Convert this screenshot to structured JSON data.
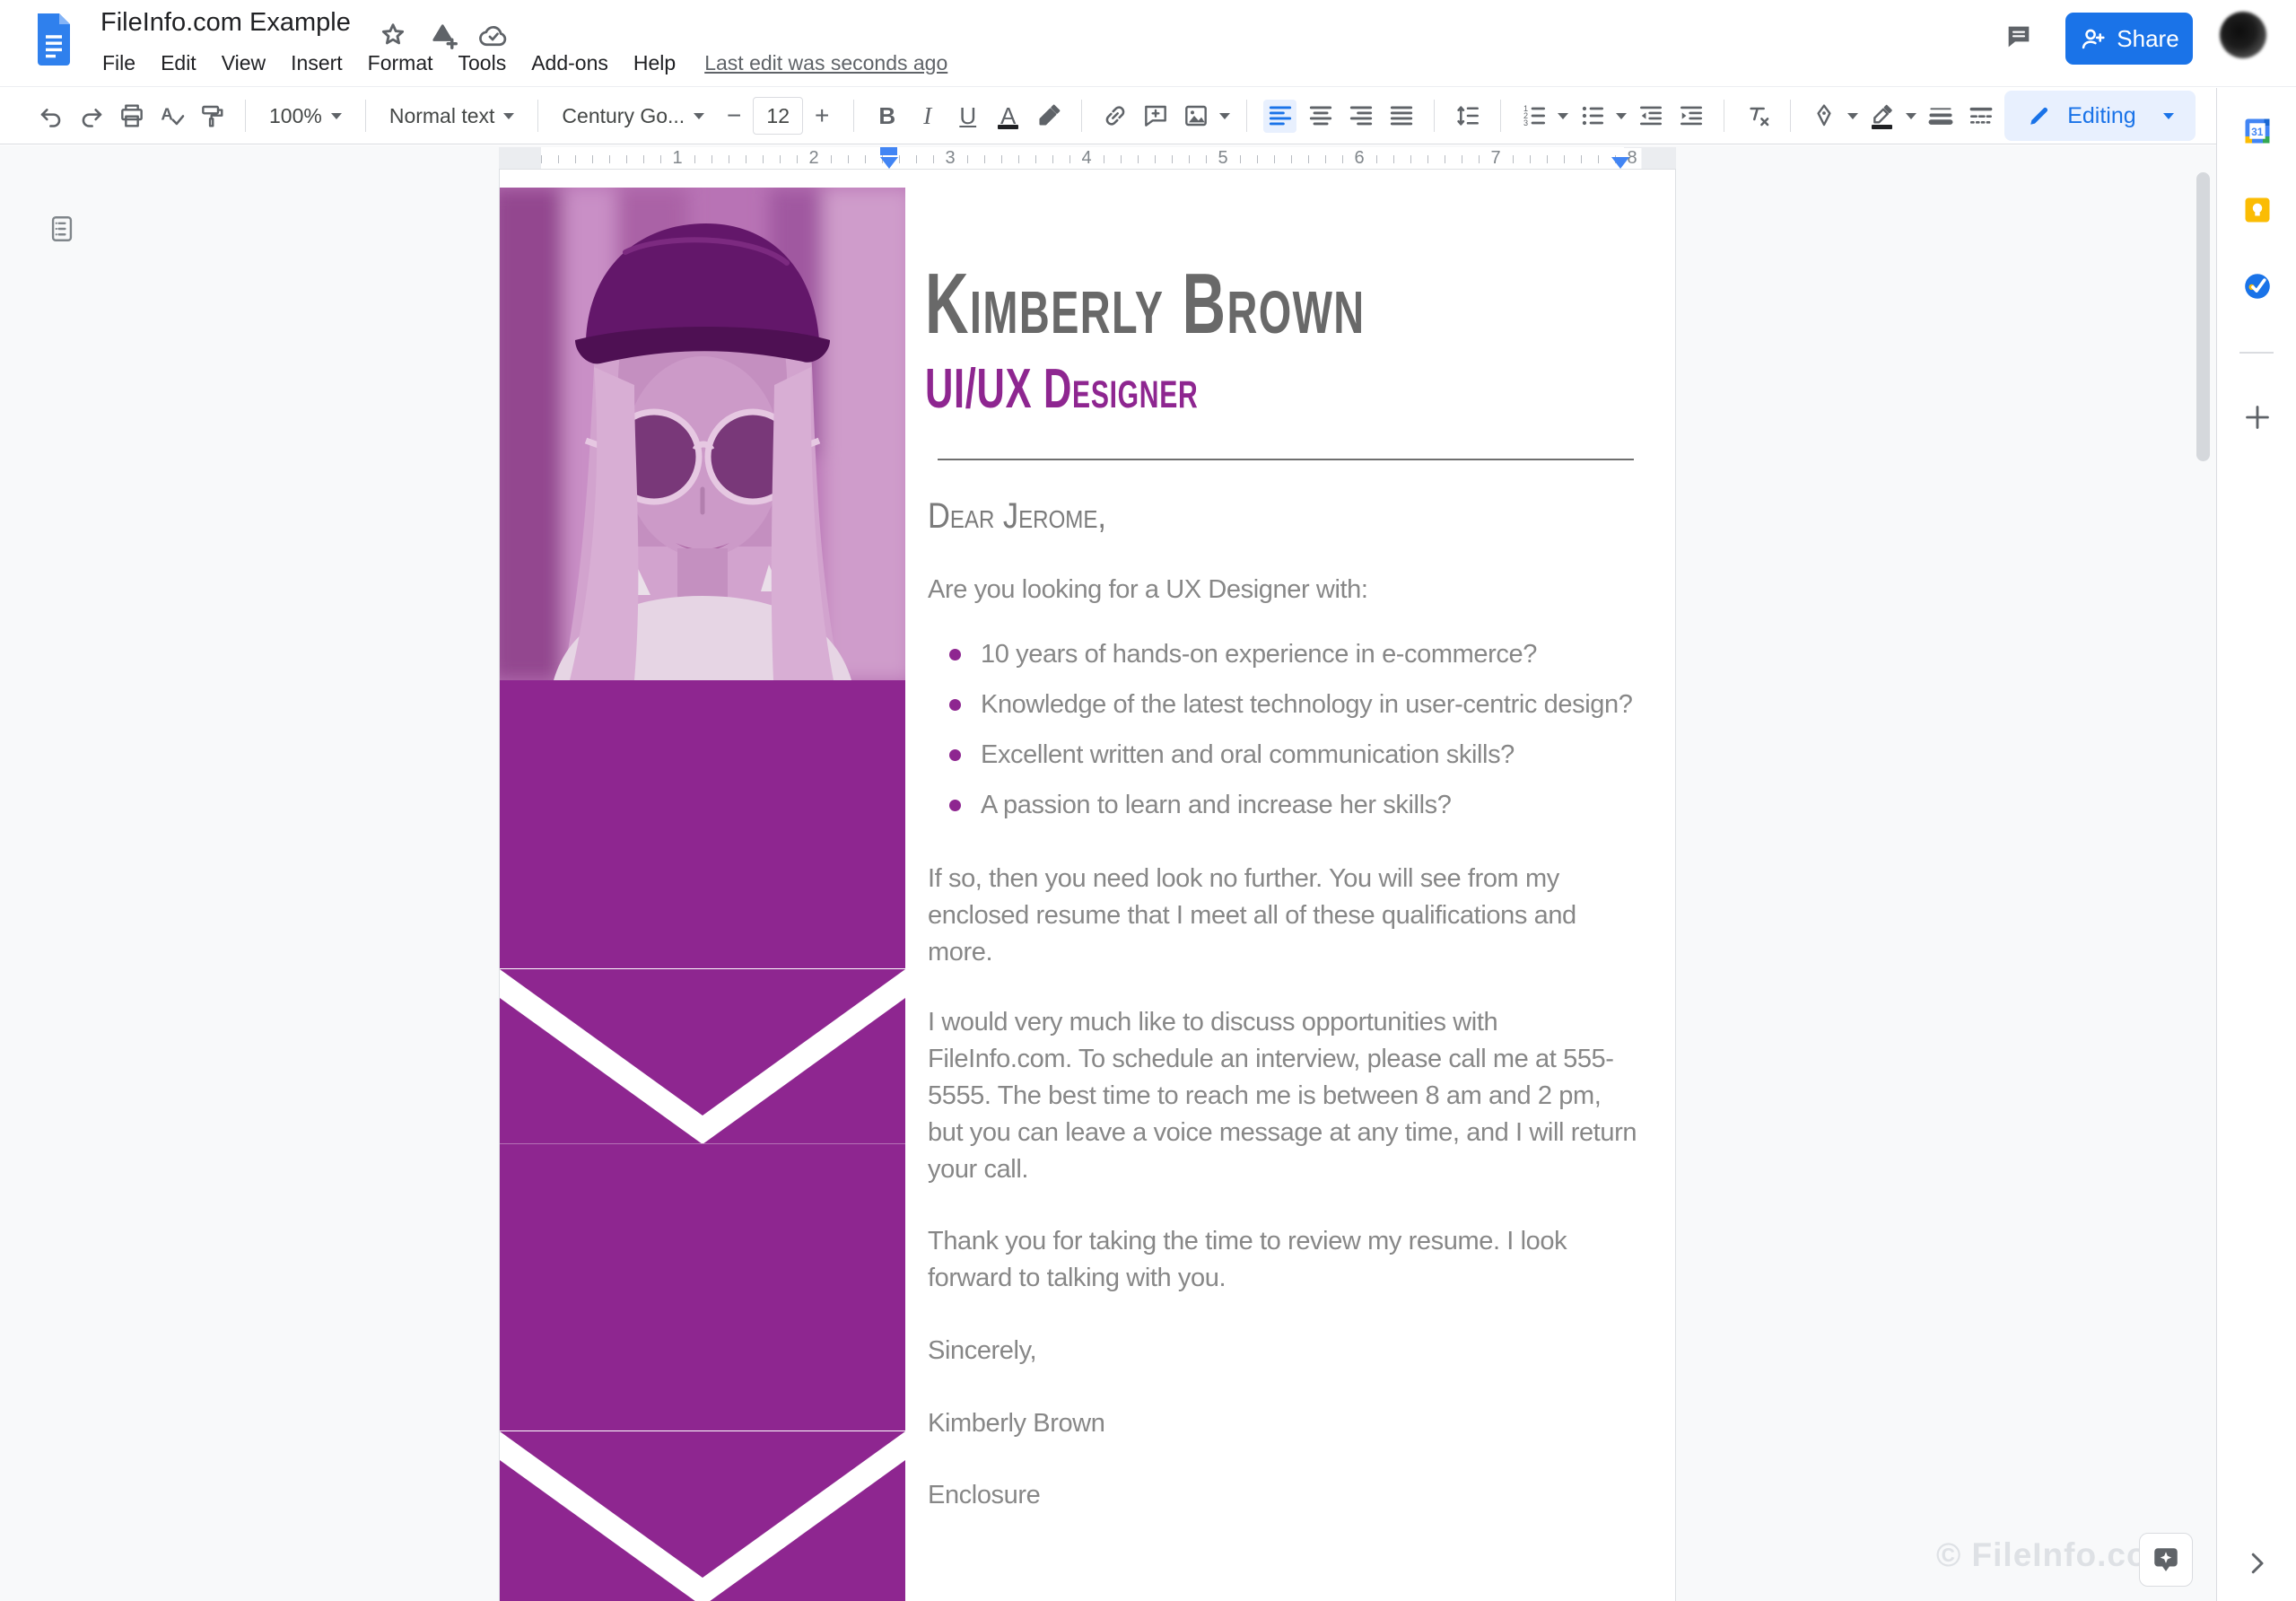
{
  "app": {
    "title": "FileInfo.com Example",
    "menu": [
      "File",
      "Edit",
      "View",
      "Insert",
      "Format",
      "Tools",
      "Add-ons",
      "Help"
    ],
    "last_edit": "Last edit was seconds ago",
    "share_label": "Share",
    "mode_label": "Editing"
  },
  "toolbar": {
    "zoom": "100%",
    "style": "Normal text",
    "font": "Century Go...",
    "font_size": "12",
    "glyphs": {
      "minus": "−",
      "plus": "+",
      "bold": "B",
      "italic": "I",
      "underline": "U",
      "text_color": "A"
    }
  },
  "ruler": {
    "numbers": [
      "1",
      "2",
      "3",
      "4",
      "5",
      "6",
      "7",
      "8"
    ]
  },
  "document": {
    "name_heading": "Kimberly Brown",
    "title_heading": "UI/UX Designer",
    "salutation": "Dear Jerome,",
    "intro": "Are you looking for a UX Designer with:",
    "bullets": [
      "10 years of hands-on experience in e-commerce?",
      "Knowledge of the latest technology in user-centric design?",
      "Excellent written and oral communication skills?",
      "A passion to learn and increase her skills?"
    ],
    "para1": "If so, then you need look no further. You will see from my enclosed resume that I meet all of these qualifications and more.",
    "para2": "I would very much like to discuss opportunities with FileInfo.com. To schedule an interview, please call me at 555-5555. The best time to reach me is between 8 am and 2 pm, but you can leave a voice message at any time, and I will return your call.",
    "para3": "Thank you for taking the time to review my resume. I look forward to talking with you.",
    "closing": "Sincerely,",
    "signature": "Kimberly Brown",
    "enclosure": "Enclosure"
  },
  "watermark": "© FileInfo.com",
  "colors": {
    "accent_purple": "#8e2690",
    "google_blue": "#1a73e8"
  }
}
